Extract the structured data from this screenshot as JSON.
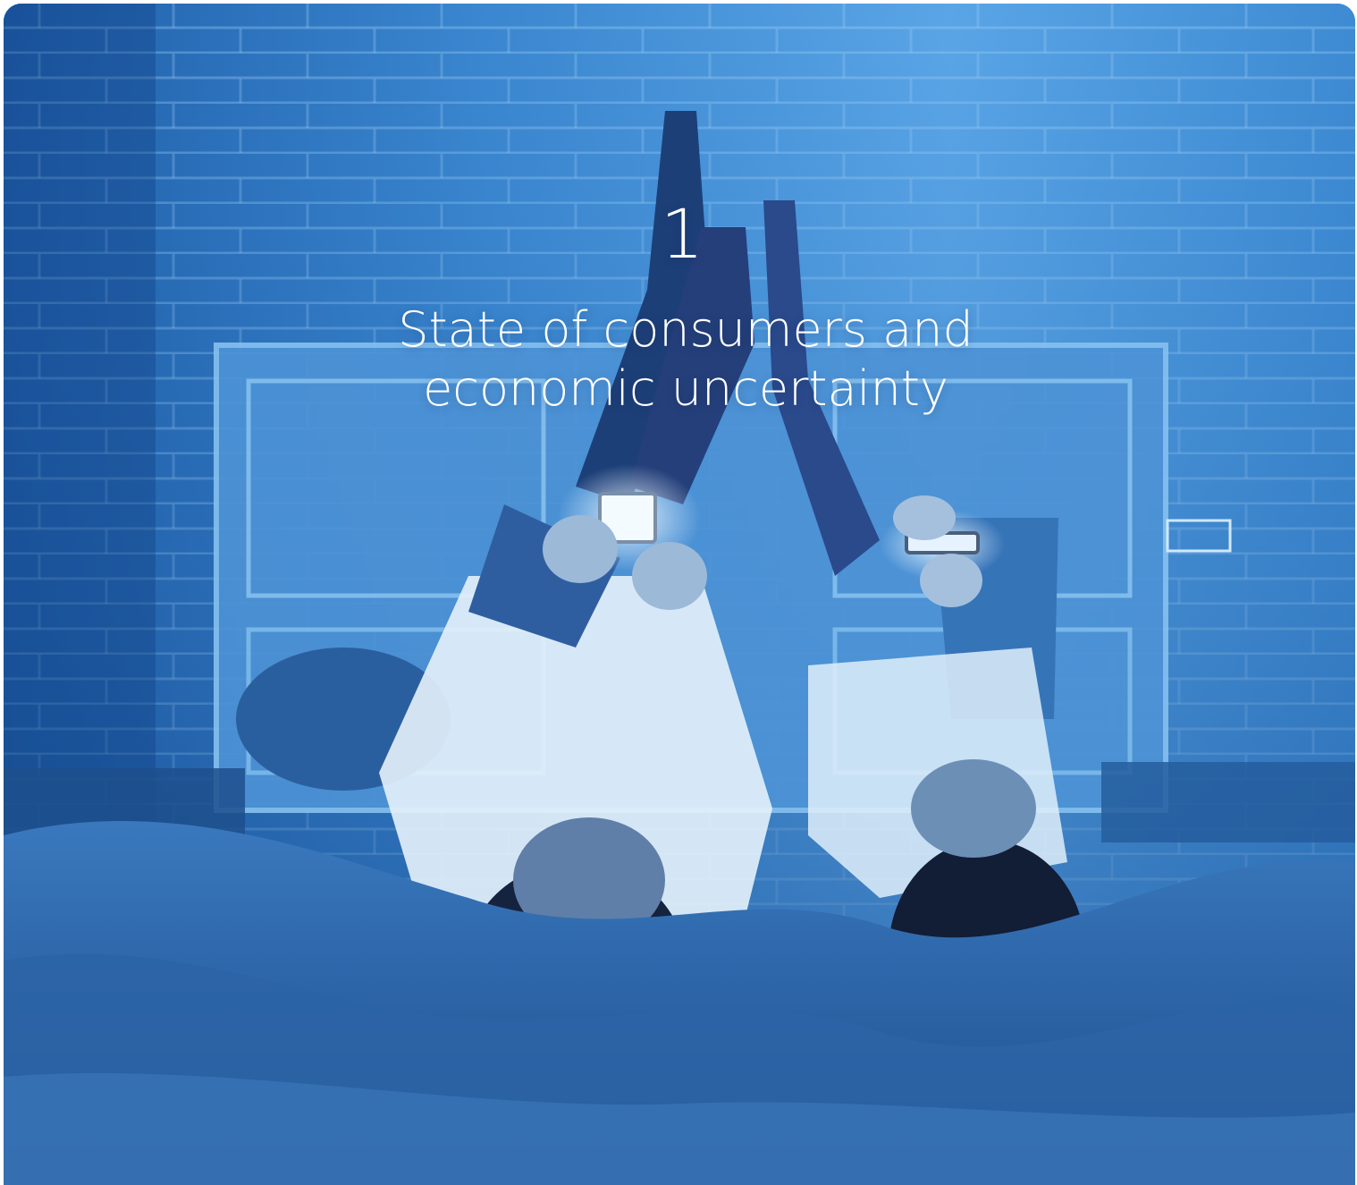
{
  "hero": {
    "chapter_number": "1",
    "chapter_title": "State of consumers and economic uncertainty"
  },
  "colors": {
    "wall": "#3f8fd6",
    "wall_bright": "#6fb3ee",
    "shadow": "#0f2f63",
    "bedding": "#2e68ad",
    "text": "#ffffff"
  }
}
